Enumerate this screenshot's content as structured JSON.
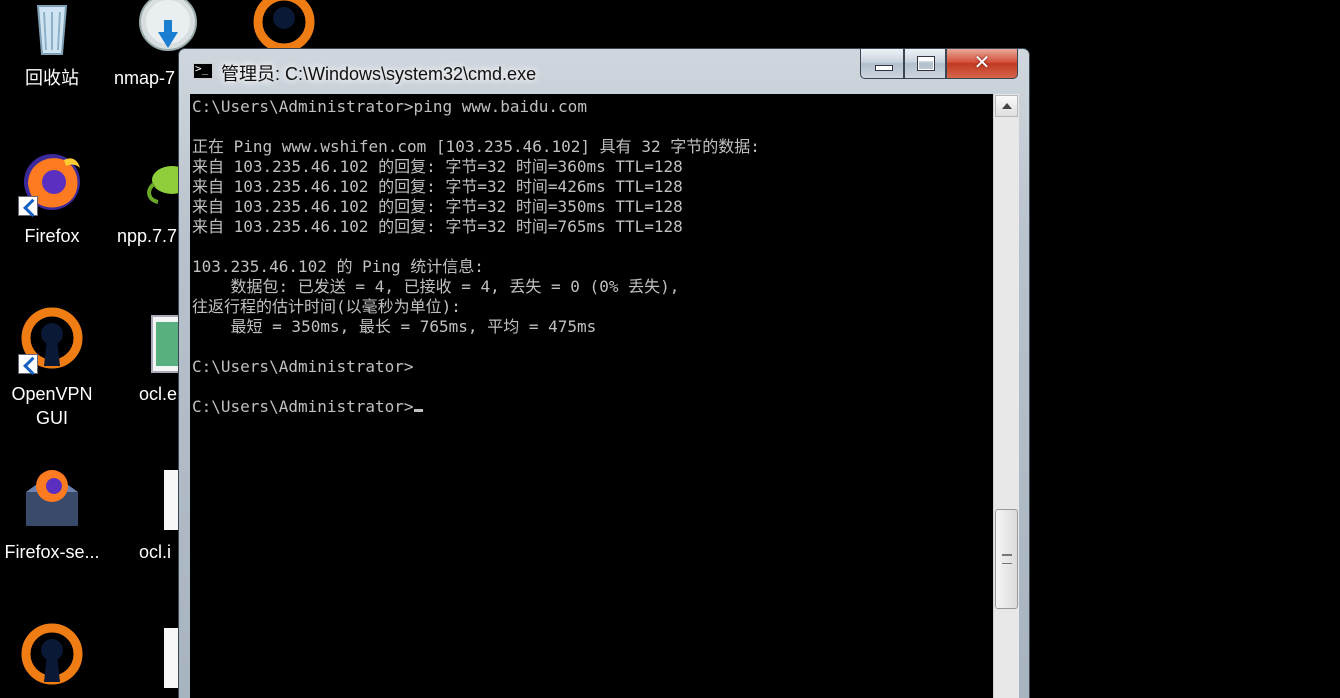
{
  "desktop": {
    "icons": [
      {
        "label": "回收站"
      },
      {
        "label": "nmap-7"
      },
      {
        "label": "Firefox"
      },
      {
        "label": "npp.7.7"
      },
      {
        "label": "OpenVPN\nGUI"
      },
      {
        "label": "ocl.e"
      },
      {
        "label": "Firefox-se..."
      },
      {
        "label": "ocl.i"
      }
    ]
  },
  "window": {
    "title": "管理员: C:\\Windows\\system32\\cmd.exe"
  },
  "console": {
    "lines": [
      "C:\\Users\\Administrator>ping www.baidu.com",
      "",
      "正在 Ping www.wshifen.com [103.235.46.102] 具有 32 字节的数据:",
      "来自 103.235.46.102 的回复: 字节=32 时间=360ms TTL=128",
      "来自 103.235.46.102 的回复: 字节=32 时间=426ms TTL=128",
      "来自 103.235.46.102 的回复: 字节=32 时间=350ms TTL=128",
      "来自 103.235.46.102 的回复: 字节=32 时间=765ms TTL=128",
      "",
      "103.235.46.102 的 Ping 统计信息:",
      "    数据包: 已发送 = 4, 已接收 = 4, 丢失 = 0 (0% 丢失),",
      "往返行程的估计时间(以毫秒为单位):",
      "    最短 = 350ms, 最长 = 765ms, 平均 = 475ms",
      "",
      "C:\\Users\\Administrator>",
      "",
      "C:\\Users\\Administrator>"
    ]
  }
}
